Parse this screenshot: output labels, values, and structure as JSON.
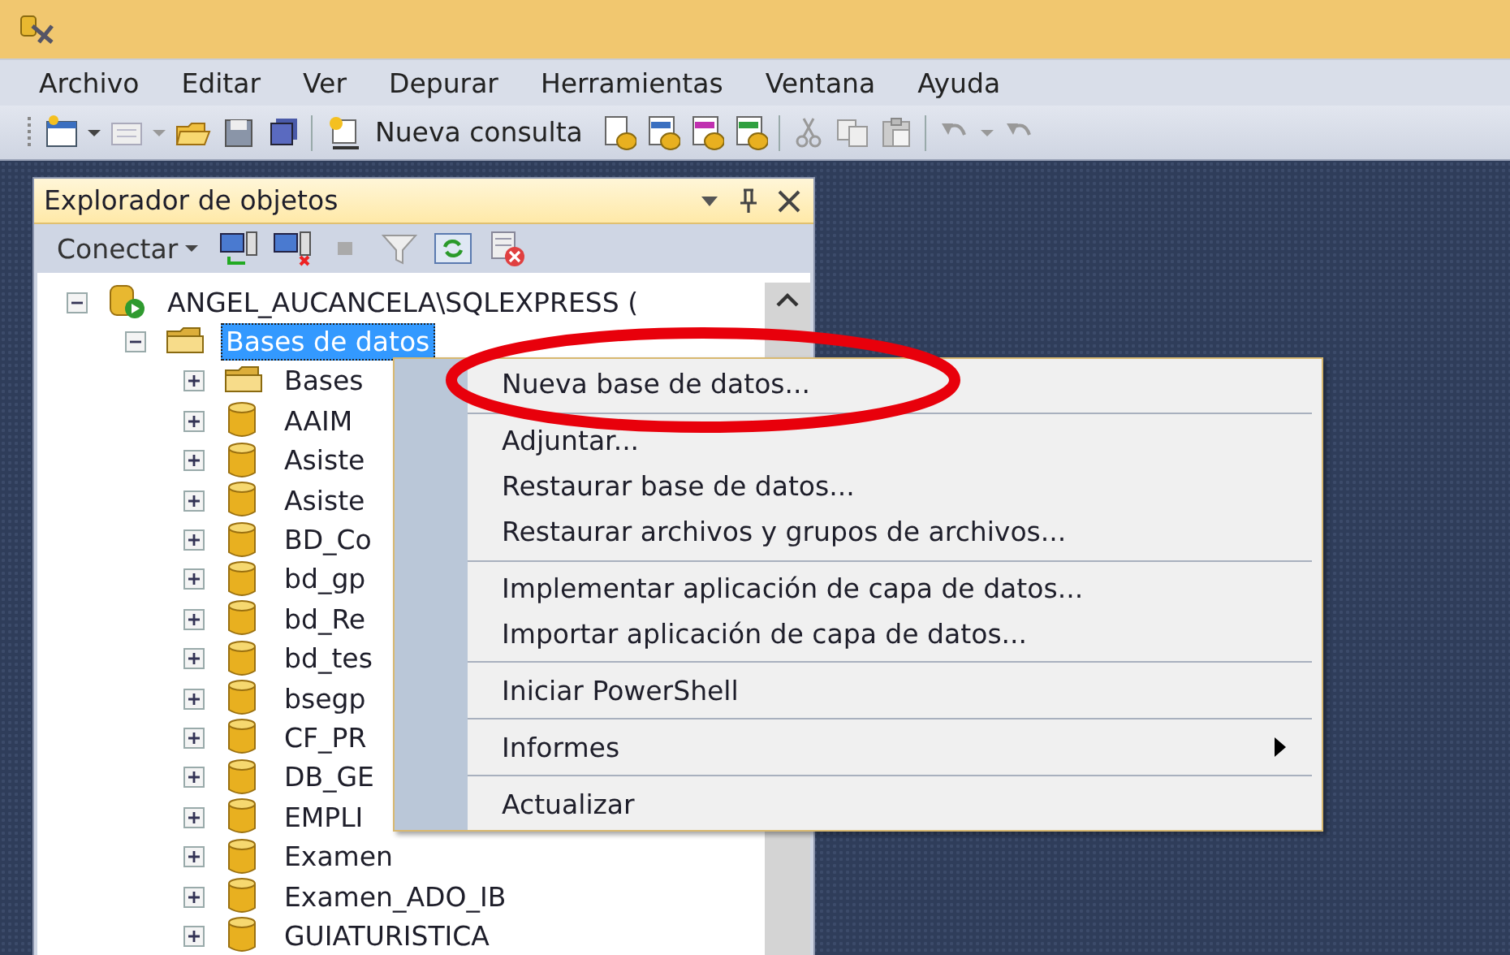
{
  "menu_bar": [
    "Archivo",
    "Editar",
    "Ver",
    "Depurar",
    "Herramientas",
    "Ventana",
    "Ayuda"
  ],
  "toolbar": {
    "new_query_label": "Nueva consulta"
  },
  "object_explorer": {
    "title": "Explorador de objetos",
    "connect_label": "Conectar",
    "tree": [
      {
        "label": "ANGEL_AUCANCELA\\SQLEXPRESS (",
        "kind": "server",
        "expanded": true,
        "selected": false,
        "children": [
          {
            "label": "Bases de datos",
            "kind": "folder",
            "expanded": true,
            "selected": true,
            "children": [
              {
                "label": "Bases",
                "kind": "folder",
                "expanded": false,
                "selected": false
              },
              {
                "label": "AAIM",
                "kind": "database",
                "expanded": false,
                "selected": false
              },
              {
                "label": "Asiste",
                "kind": "database",
                "expanded": false,
                "selected": false
              },
              {
                "label": "Asiste",
                "kind": "database",
                "expanded": false,
                "selected": false
              },
              {
                "label": "BD_Co",
                "kind": "database",
                "expanded": false,
                "selected": false
              },
              {
                "label": "bd_gp",
                "kind": "database",
                "expanded": false,
                "selected": false
              },
              {
                "label": "bd_Re",
                "kind": "database",
                "expanded": false,
                "selected": false
              },
              {
                "label": "bd_tes",
                "kind": "database",
                "expanded": false,
                "selected": false
              },
              {
                "label": "bsegp",
                "kind": "database",
                "expanded": false,
                "selected": false
              },
              {
                "label": "CF_PR",
                "kind": "database",
                "expanded": false,
                "selected": false
              },
              {
                "label": "DB_GE",
                "kind": "database",
                "expanded": false,
                "selected": false
              },
              {
                "label": "EMPLI",
                "kind": "database",
                "expanded": false,
                "selected": false
              },
              {
                "label": "Examen",
                "kind": "database",
                "expanded": false,
                "selected": false
              },
              {
                "label": "Examen_ADO_IB",
                "kind": "database",
                "expanded": false,
                "selected": false
              },
              {
                "label": "GUIATURISTICA",
                "kind": "database",
                "expanded": false,
                "selected": false
              }
            ]
          }
        ]
      }
    ]
  },
  "context_menu": [
    {
      "kind": "item",
      "label": "Nueva base de datos...",
      "submenu": false
    },
    {
      "kind": "separator"
    },
    {
      "kind": "item",
      "label": "Adjuntar...",
      "submenu": false
    },
    {
      "kind": "item",
      "label": "Restaurar base de datos...",
      "submenu": false
    },
    {
      "kind": "item",
      "label": "Restaurar archivos y grupos de archivos...",
      "submenu": false
    },
    {
      "kind": "separator"
    },
    {
      "kind": "item",
      "label": "Implementar aplicación de capa de datos...",
      "submenu": false
    },
    {
      "kind": "item",
      "label": "Importar aplicación de capa de datos...",
      "submenu": false
    },
    {
      "kind": "separator"
    },
    {
      "kind": "item",
      "label": "Iniciar PowerShell",
      "submenu": false
    },
    {
      "kind": "separator"
    },
    {
      "kind": "item",
      "label": "Informes",
      "submenu": true
    },
    {
      "kind": "separator"
    },
    {
      "kind": "item",
      "label": "Actualizar",
      "submenu": false
    }
  ]
}
